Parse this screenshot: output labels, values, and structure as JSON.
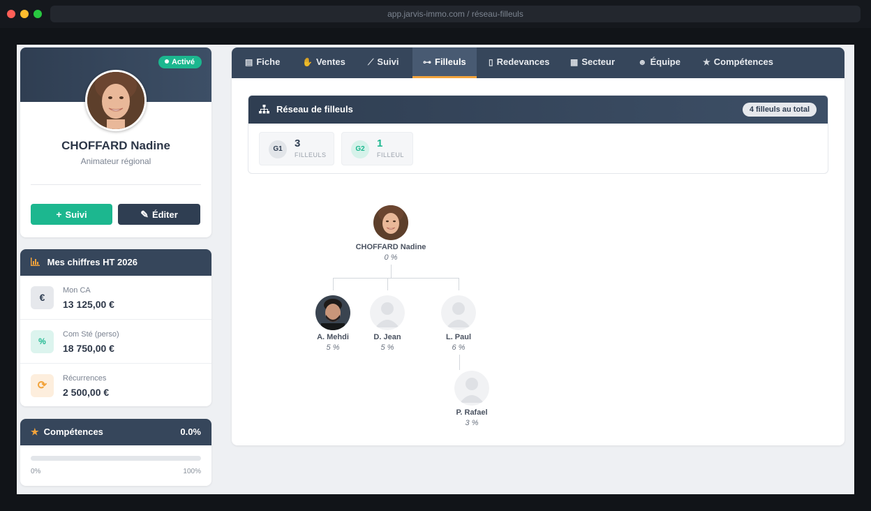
{
  "browser": {
    "url": "app.jarvis-immo.com / réseau-filleuls"
  },
  "profile": {
    "status": "Activé",
    "name": "CHOFFARD Nadine",
    "role": "Animateur régional",
    "follow_label": "Suivi",
    "edit_label": "Éditer"
  },
  "stats": {
    "title": "Mes chiffres HT 2026",
    "items": [
      {
        "label": "Mon CA",
        "value": "13 125,00 €",
        "icon": "euro-icon",
        "glyph": "€"
      },
      {
        "label": "Com Sté (perso)",
        "value": "18 750,00 €",
        "icon": "percent-icon",
        "glyph": "%"
      },
      {
        "label": "Récurrences",
        "value": "2 500,00 €",
        "icon": "sync-icon",
        "glyph": "⟳"
      }
    ]
  },
  "competences": {
    "title": "Compétences",
    "percent": "0.0%",
    "progress": 0,
    "min_label": "0%",
    "max_label": "100%"
  },
  "tabs": [
    {
      "label": "Fiche",
      "icon": "id-card-icon"
    },
    {
      "label": "Ventes",
      "icon": "handshake-icon"
    },
    {
      "label": "Suivi",
      "icon": "chart-line-icon"
    },
    {
      "label": "Filleuls",
      "icon": "sitemap-icon",
      "active": true
    },
    {
      "label": "Redevances",
      "icon": "file-invoice-icon"
    },
    {
      "label": "Secteur",
      "icon": "map-icon"
    },
    {
      "label": "Équipe",
      "icon": "users-icon"
    },
    {
      "label": "Compétences",
      "icon": "star-icon"
    }
  ],
  "network": {
    "title": "Réseau de filleuls",
    "total_badge": "4 filleuls au total",
    "generations": [
      {
        "code": "G1",
        "count": "3",
        "label": "FILLEULS"
      },
      {
        "code": "G2",
        "count": "1",
        "label": "FILLEUL"
      }
    ]
  },
  "tree": {
    "root": {
      "name": "CHOFFARD Nadine",
      "pct": "0 %"
    },
    "children": [
      {
        "name": "A. Mehdi",
        "pct": "5 %"
      },
      {
        "name": "D. Jean",
        "pct": "5 %"
      },
      {
        "name": "L. Paul",
        "pct": "6 %"
      }
    ],
    "grandchildren": [
      {
        "name": "P. Rafael",
        "pct": "3 %"
      }
    ]
  },
  "colors": {
    "accent": "#1cb78f",
    "dark": "#36465b",
    "tab_highlight": "#f2a33b"
  }
}
